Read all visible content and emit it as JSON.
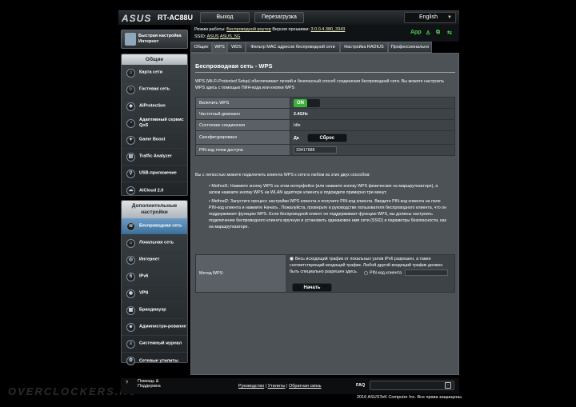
{
  "header": {
    "logo": "ASUS",
    "model": "RT-AC88U",
    "logout": "Выход",
    "reboot": "Перезагрузка",
    "language": "English"
  },
  "info": {
    "mode_label": "Режим работы:",
    "mode_value": "Беспроводной роутер",
    "fw_label": "Версия прошивки:",
    "fw_value": "3.0.0.4.380_3343",
    "ssid_label": "SSID:",
    "ssid1": "ASUS",
    "ssid2": "ASUS_5G",
    "app": "App"
  },
  "sidebar": {
    "quick": "Быстрая настройка Интернет",
    "general_title": "Общие",
    "general": [
      "Карта сети",
      "Гостевая сеть",
      "AiProtection",
      "Адаптивный сервис QoS",
      "Game Boost",
      "Traffic Analyzer",
      "USB-приложение",
      "AiCloud 2.0"
    ],
    "advanced_title": "Дополнительные настройки",
    "advanced": [
      "Беспроводная сеть",
      "Локальная сеть",
      "Интернет",
      "IPv6",
      "VPN",
      "Брандмауэр",
      "Администри-рование",
      "Системный журнал",
      "Сетевые утилиты"
    ]
  },
  "tabs": [
    "Общие",
    "WPS",
    "WDS",
    "Фильтр MAC адресов беспроводной сети",
    "Настройка RADIUS",
    "Профессионально"
  ],
  "main": {
    "title": "Беспроводная сеть - WPS",
    "intro": "WPS (Wi-Fi Protected Setup) обеспечивает легкий и безопасный способ соединения беспроводной сети. Вы можете настроить WPS здесь с помощью ПИН-кода или кнопки WPS",
    "rows": [
      {
        "label": "Включить WPS",
        "value": "ON"
      },
      {
        "label": "Частотный диапазон",
        "value": "2.4GHz"
      },
      {
        "label": "Состояние соединения",
        "value": "Idle"
      },
      {
        "label": "Сконфигурировано",
        "value": "Да",
        "button": "Сброс"
      },
      {
        "label": "PIN-код точки доступа",
        "value": "33417686"
      }
    ],
    "connect_intro": "Вы с легкостью можете подключить клиента WPS к сети в любом из этих двух способов:",
    "method1": "Method1: Нажмите кнопку WPS на этом интерфейсе (или нажмите кнопку WPS физических на маршрутизаторе), а затем нажмите кнопку WPS на WLAN адаптере клиента и подождите примерно три минут.",
    "method2": "Method2: Запустите процесс настройки WPS клиента и получите PIN-код клиента. Введите PIN-код клиента на поле PIN-код клиента и нажмите Начать . Пожалуйста, проверьте в руководстве пользователя беспроводного клиента, что он поддерживает функцию WPS. Если беспроводной клиент не поддерживает функцию WPS, вы должны настроить подключение беспроводного клиента вручную и установить одинаковое имя сети (SSID) и параметры безопасности, как на маршрутизаторе.",
    "method_label": "Метод WPS:",
    "option1": "Весь исходящий трафик от локальных узлов IPv6 разрешен, а также соответствующий входящий трафик. Любой другой входящий трафик должен быть специально разрешен здесь.",
    "option2": "PIN-код клиента",
    "start": "Начать"
  },
  "footer": {
    "help": "Помощь & Поддержка",
    "manual": "Руководство",
    "utilities": "Утилиты",
    "feedback": "Обратная связь",
    "faq": "FAQ",
    "copyright": "2016 ASUSTeK Computer Inc. Все права защищены.",
    "watermark": "OVERCLOCKERS.RU"
  }
}
